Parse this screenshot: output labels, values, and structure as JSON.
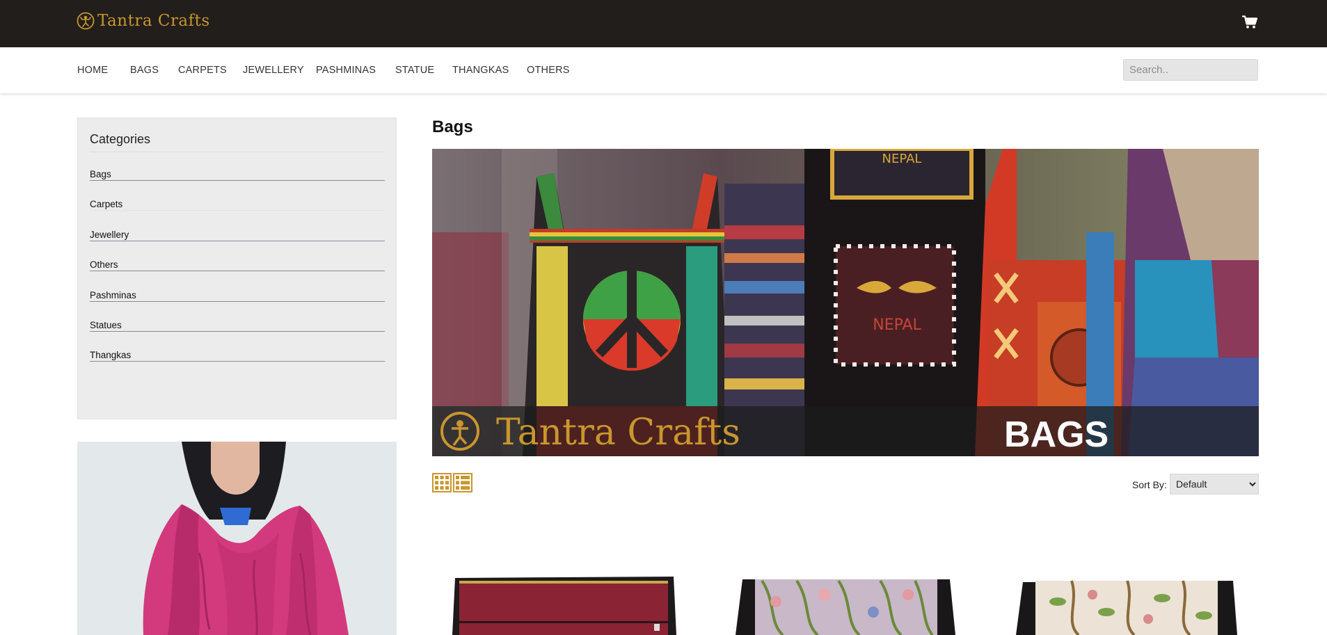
{
  "header": {
    "logo_text": "Tantra Crafts",
    "brand_color": "#c9962d",
    "background": "#221e1b",
    "cart_icon": "shopping-cart-icon"
  },
  "nav": {
    "items": [
      "HOME",
      "BAGS",
      "CARPETS",
      "JEWELLERY",
      "PASHMINAS",
      "STATUE",
      "THANGKAS",
      "OTHERS"
    ],
    "search_placeholder": "Search.."
  },
  "sidebar": {
    "title": "Categories",
    "items": [
      "Bags",
      "Carpets",
      "Jewellery",
      "Others",
      "Pashminas",
      "Statues",
      "Thangkas"
    ]
  },
  "main": {
    "title": "Bags",
    "banner_brand": "Tantra Crafts",
    "banner_label": "BAGS",
    "banner_word_top": "NEPAL",
    "banner_word_mid": "NEPAL",
    "grid_icon": "grid-view-icon",
    "list_icon": "list-view-icon",
    "sort_label": "Sort By:",
    "sort_value": "Default"
  }
}
